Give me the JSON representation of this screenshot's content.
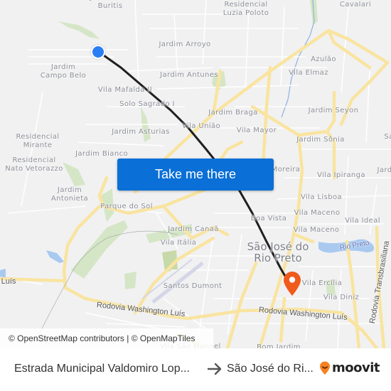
{
  "map": {
    "labels": [
      {
        "id": "jardim-dos-buritis",
        "text": "Jardim dos\nBuritis",
        "type": "area"
      },
      {
        "id": "residencial-luzia-poloto",
        "text": "Residencial\nLuzia Poloto",
        "type": "area"
      },
      {
        "id": "cavalari",
        "text": "Cavalari",
        "type": "area"
      },
      {
        "id": "jardim-arroyo",
        "text": "Jardim Arroyo",
        "type": "area"
      },
      {
        "id": "azulao",
        "text": "Azulão",
        "type": "area"
      },
      {
        "id": "jardim-campo-belo",
        "text": "Jardim\nCampo Belo",
        "type": "area"
      },
      {
        "id": "jardim-antunes",
        "text": "Jardim Antunes",
        "type": "area"
      },
      {
        "id": "vila-elmaz",
        "text": "Vila Elmaz",
        "type": "area"
      },
      {
        "id": "vila-mafalda-ii",
        "text": "Vila Mafalda II",
        "type": "area"
      },
      {
        "id": "solo-sagrado-i",
        "text": "Solo Sagrado I",
        "type": "area"
      },
      {
        "id": "jardim-braga",
        "text": "Jardim Braga",
        "type": "area"
      },
      {
        "id": "jardim-seyon",
        "text": "Jardim Seyon",
        "type": "area"
      },
      {
        "id": "vila-uniao",
        "text": "Vila União",
        "type": "area"
      },
      {
        "id": "jardim-asturias",
        "text": "Jardim Asturias",
        "type": "area"
      },
      {
        "id": "vila-mayor",
        "text": "Vila Mayor",
        "type": "area"
      },
      {
        "id": "residencial-mirante",
        "text": "Residencial\nMirante",
        "type": "area"
      },
      {
        "id": "jardim-sonia",
        "text": "Jardim Sônia",
        "type": "area"
      },
      {
        "id": "sa",
        "text": "Sa",
        "type": "area"
      },
      {
        "id": "jardim-bianco",
        "text": "Jardim Bianco",
        "type": "area"
      },
      {
        "id": "residencial-nato-vetorazzo",
        "text": "Residencial\nNato Vetorazzo",
        "type": "area"
      },
      {
        "id": "moreira",
        "text": "Moreira",
        "type": "area"
      },
      {
        "id": "vila-ipiranga",
        "text": "Vila Ipiranga",
        "type": "area"
      },
      {
        "id": "jard",
        "text": "Jard",
        "type": "area"
      },
      {
        "id": "jardim-antonieta",
        "text": "Jardim\nAntonieta",
        "type": "area"
      },
      {
        "id": "vila-lisboa",
        "text": "Vila Lisboa",
        "type": "area"
      },
      {
        "id": "parque-do-sol",
        "text": "Parque do Sol",
        "type": "area"
      },
      {
        "id": "boa-vista",
        "text": "Boa Vista",
        "type": "area"
      },
      {
        "id": "vila-maceno-1",
        "text": "Vila Maceno",
        "type": "area"
      },
      {
        "id": "vila-ideal",
        "text": "Vila Ideal",
        "type": "area"
      },
      {
        "id": "jardim-canaa",
        "text": "Jardim Canaã",
        "type": "area"
      },
      {
        "id": "vila-maceno-2",
        "text": "Vila Maceno",
        "type": "area"
      },
      {
        "id": "vila-italia",
        "text": "Vila Itália",
        "type": "area"
      },
      {
        "id": "sao-jose-do-rio-preto",
        "text": "São José do\nRio Preto",
        "type": "city"
      },
      {
        "id": "rio-preto",
        "text": "Rio Preto",
        "type": "river"
      },
      {
        "id": "rodovia-transbrasiliana",
        "text": "Rodovia Transbrasiliana",
        "type": "road"
      },
      {
        "id": "luis",
        "text": "Luís",
        "type": "road"
      },
      {
        "id": "vila-ercilia",
        "text": "Vila Ercília",
        "type": "area"
      },
      {
        "id": "santos-dumont",
        "text": "Santos Dumont",
        "type": "area"
      },
      {
        "id": "vila-diniz",
        "text": "Vila Diniz",
        "type": "area"
      },
      {
        "id": "rodovia-washington-luis-1",
        "text": "Rodovia Washington Luís",
        "type": "road"
      },
      {
        "id": "rodovia-washington-luis-2",
        "text": "Rodovia Washington Luís",
        "type": "road"
      },
      {
        "id": "vila-sao-manoel",
        "text": "Vila São Manoel",
        "type": "area"
      },
      {
        "id": "bom-jardim",
        "text": "Bom Jardim",
        "type": "area"
      }
    ],
    "attribution": {
      "osm": "© OpenStreetMap contributors",
      "separator": " | ",
      "omt": "© OpenMapTiles"
    },
    "origin_marker": "origin-location-icon",
    "destination_marker": "destination-pin-icon",
    "route_color": "#1f1f1f",
    "origin_color": "#2a7ef3",
    "destination_color": "#f05a1a"
  },
  "cta": {
    "label": "Take me there",
    "color": "#0a6fd6"
  },
  "footer": {
    "origin": "Estrada Municipal Valdomiro Lop...",
    "arrow_icon": "arrow-right-icon",
    "destination": "São José do Ri...",
    "brand": "moovit",
    "brand_color": "#f7811f"
  }
}
